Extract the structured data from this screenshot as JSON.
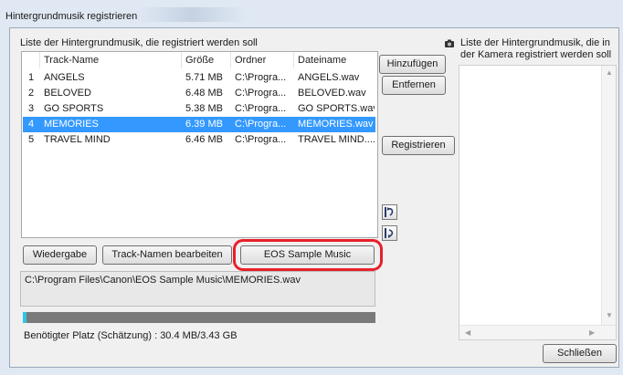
{
  "window": {
    "title": "Hintergrundmusik registrieren"
  },
  "left_panel": {
    "list_label": "Liste der Hintergrundmusik, die registriert werden soll",
    "columns": [
      "Track-Name",
      "Größe",
      "Ordner",
      "Dateiname"
    ],
    "rows": [
      {
        "num": "1",
        "name": "ANGELS",
        "size": "5.71 MB",
        "folder": "C:\\Progra...",
        "file": "ANGELS.wav",
        "selected": false
      },
      {
        "num": "2",
        "name": "BELOVED",
        "size": "6.48 MB",
        "folder": "C:\\Progra...",
        "file": "BELOVED.wav",
        "selected": false
      },
      {
        "num": "3",
        "name": "GO SPORTS",
        "size": "5.38 MB",
        "folder": "C:\\Progra...",
        "file": "GO SPORTS.wav",
        "selected": false
      },
      {
        "num": "4",
        "name": "MEMORIES",
        "size": "6.39 MB",
        "folder": "C:\\Progra...",
        "file": "MEMORIES.wav",
        "selected": true
      },
      {
        "num": "5",
        "name": "TRAVEL MIND",
        "size": "6.46 MB",
        "folder": "C:\\Progra...",
        "file": "TRAVEL MIND....",
        "selected": false
      }
    ],
    "buttons": {
      "playback": "Wiedergabe",
      "edit_names": "Track-Namen bearbeiten",
      "eos_sample": "EOS Sample Music"
    },
    "path": "C:\\Program Files\\Canon\\EOS Sample Music\\MEMORIES.wav",
    "progress_fraction": 0.01,
    "space_label": "Benötigter Platz (Schätzung) : 30.4 MB/3.43 GB"
  },
  "middle_buttons": {
    "add": "Hinzufügen",
    "remove": "Entfernen",
    "register": "Registrieren"
  },
  "right_panel": {
    "label_line1": "Liste der Hintergrundmusik, die in",
    "label_line2": "der Kamera registriert werden soll"
  },
  "close_button": "Schließen",
  "colors": {
    "selection": "#3399ff",
    "highlight": "#e8202a",
    "progress": "#2ec6e8"
  }
}
